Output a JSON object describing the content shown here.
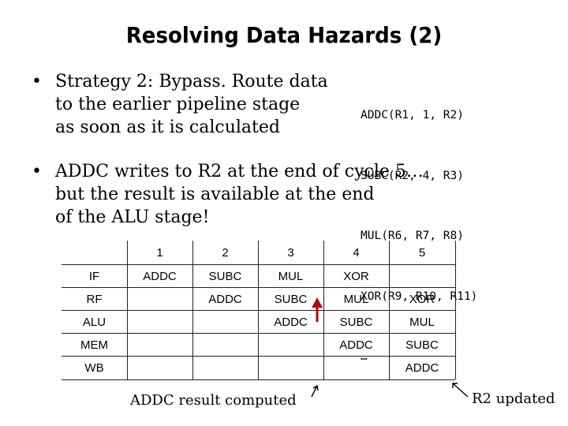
{
  "title": "Resolving Data Hazards (2)",
  "bullets": [
    {
      "marker": "•",
      "lines": [
        "Strategy 2: Bypass. Route data",
        "to the earlier pipeline stage",
        "as soon as it is calculated"
      ]
    },
    {
      "marker": "•",
      "lines": [
        "ADDC writes to R2 at the end of cycle 5…",
        "but the result is available at the end",
        "of the ALU stage!"
      ]
    }
  ],
  "code_lines": [
    "ADDC(R1, 1, R2)",
    "SUBC(R2, 4, R3)",
    "MUL(R6, R7, R8)",
    "XOR(R9, R10, R11)",
    "…"
  ],
  "pipeline_table": {
    "columns": [
      "1",
      "2",
      "3",
      "4",
      "5"
    ],
    "rows": [
      {
        "stage": "IF",
        "cells": [
          "ADDC",
          "SUBC",
          "MUL",
          "XOR",
          ""
        ]
      },
      {
        "stage": "RF",
        "cells": [
          "",
          "ADDC",
          "SUBC",
          "MUL",
          "XOR"
        ]
      },
      {
        "stage": "ALU",
        "cells": [
          "",
          "",
          "ADDC",
          "SUBC",
          "MUL"
        ]
      },
      {
        "stage": "MEM",
        "cells": [
          "",
          "",
          "",
          "ADDC",
          "SUBC"
        ]
      },
      {
        "stage": "WB",
        "cells": [
          "",
          "",
          "",
          "",
          "ADDC"
        ]
      }
    ]
  },
  "captions": {
    "alu_result": "ADDC result computed",
    "r2_updated": "R2 updated"
  },
  "colors": {
    "bypass_arrow": "#c00000"
  }
}
